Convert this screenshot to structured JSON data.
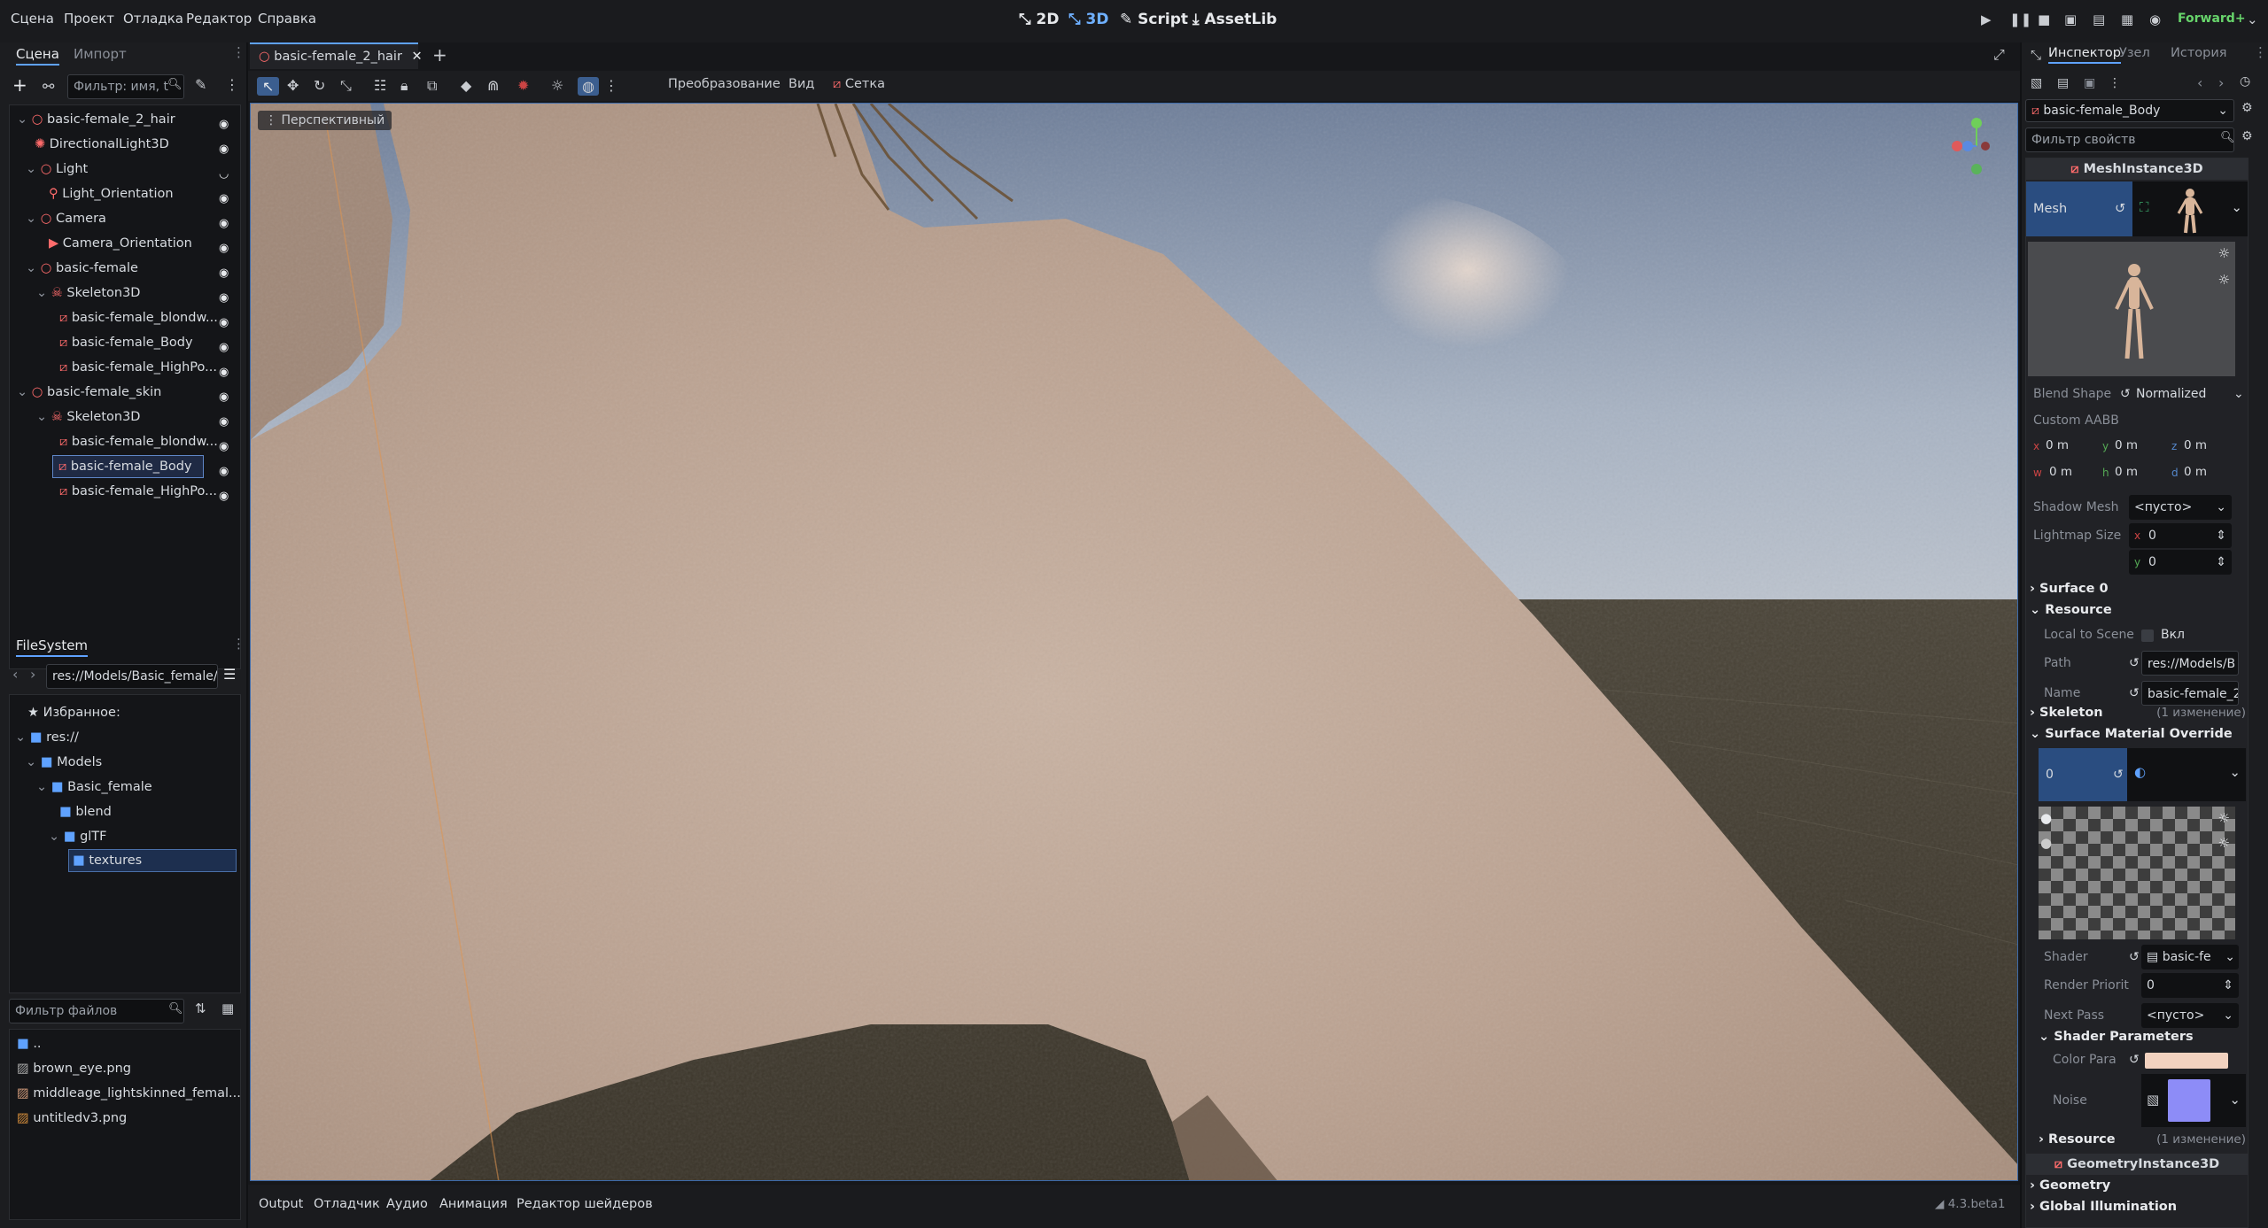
{
  "menu": [
    "Сцена",
    "Проект",
    "Отладка",
    "Редактор",
    "Справка"
  ],
  "workspaces": [
    "2D",
    "3D",
    "Script",
    "AssetLib"
  ],
  "renderer": "Forward+",
  "scene_dock": {
    "tabs": [
      "Сцена",
      "Импорт"
    ],
    "filter_placeholder": "Фильтр: имя, t",
    "tree": [
      {
        "label": "basic-female_2_hair"
      },
      {
        "label": "DirectionalLight3D"
      },
      {
        "label": "Light"
      },
      {
        "label": "Light_Orientation"
      },
      {
        "label": "Camera"
      },
      {
        "label": "Camera_Orientation"
      },
      {
        "label": "basic-female"
      },
      {
        "label": "Skeleton3D"
      },
      {
        "label": "basic-female_blondw..."
      },
      {
        "label": "basic-female_Body"
      },
      {
        "label": "basic-female_HighPo..."
      },
      {
        "label": "basic-female_skin"
      },
      {
        "label": "Skeleton3D"
      },
      {
        "label": "basic-female_blondw..."
      },
      {
        "label": "basic-female_Body"
      },
      {
        "label": "basic-female_HighPo..."
      }
    ]
  },
  "filesystem": {
    "title": "FileSystem",
    "path": "res://Models/Basic_female/",
    "tree": [
      {
        "label": "Избранное:"
      },
      {
        "label": "res://"
      },
      {
        "label": "Models"
      },
      {
        "label": "Basic_female"
      },
      {
        "label": "blend"
      },
      {
        "label": "glTF"
      },
      {
        "label": "textures"
      }
    ],
    "files_filter_placeholder": "Фильтр файлов",
    "files": [
      {
        "label": ".."
      },
      {
        "label": "brown_eye.png"
      },
      {
        "label": "middleage_lightskinned_femal..."
      },
      {
        "label": "untitledv3.png"
      }
    ]
  },
  "scene_tab": "basic-female_2_hair",
  "viewport_toolbar": {
    "transform": "Преобразование",
    "view": "Вид",
    "mesh": "Сетка"
  },
  "viewport": {
    "perspective": "Перспективный"
  },
  "bottom_panel": {
    "tabs": [
      "Output",
      "Отладчик",
      "Аудио",
      "Анимация",
      "Редактор шейдеров"
    ],
    "version": "4.3.beta1"
  },
  "inspector": {
    "tabs": [
      "Инспектор",
      "Узел",
      "История"
    ],
    "node": "basic-female_Body",
    "filter_placeholder": "Фильтр свойств",
    "class_header": "MeshInstance3D",
    "mesh_label": "Mesh",
    "blend_shape_label": "Blend Shape",
    "blend_shape_value": "Normalized",
    "custom_aabb": "Custom AABB",
    "aabb": [
      {
        "axis": "x",
        "value": "0 m"
      },
      {
        "axis": "y",
        "value": "0 m"
      },
      {
        "axis": "z",
        "value": "0 m"
      },
      {
        "axis": "w",
        "value": "0 m"
      },
      {
        "axis": "h",
        "value": "0 m"
      },
      {
        "axis": "d",
        "value": "0 m"
      }
    ],
    "shadow_mesh_label": "Shadow Mesh",
    "shadow_mesh_value": "<пусто>",
    "lightmap_label": "Lightmap Size",
    "lightmap_x": "0",
    "lightmap_y": "0",
    "surface0": "Surface 0",
    "resource": "Resource",
    "local_to_scene": "Local to Scene",
    "local_to_scene_value": "Вкл",
    "path_label": "Path",
    "path_value": "res://Models/B",
    "name_label": "Name",
    "name_value": "basic-female_2",
    "skeleton": "Skeleton",
    "skeleton_changes": "(1 изменение)",
    "surface_override": "Surface Material Override",
    "override_index": "0",
    "shader_label": "Shader",
    "shader_value": "basic-fe",
    "render_priority_label": "Render Priorit",
    "render_priority_value": "0",
    "next_pass_label": "Next Pass",
    "next_pass_value": "<пусто>",
    "shader_params": "Shader Parameters",
    "color_param": "Color Para",
    "color_value": "#f2d2bf",
    "noise": "Noise",
    "resource2": "Resource",
    "resource2_changes": "(1 изменение)",
    "geometry_instance": "GeometryInstance3D",
    "geometry": "Geometry",
    "global_illumination": "Global Illumination"
  }
}
